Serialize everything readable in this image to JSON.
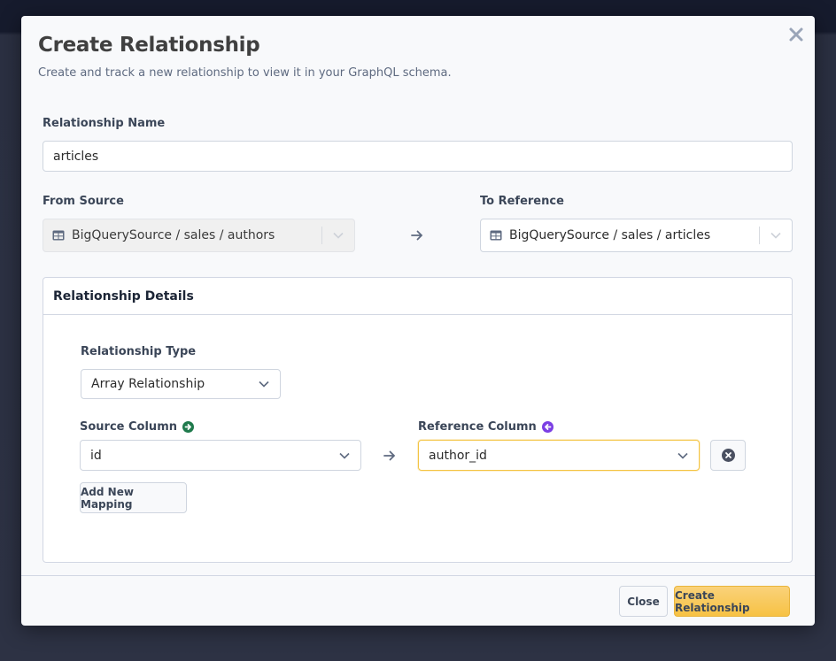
{
  "modal": {
    "title": "Create Relationship",
    "subtitle": "Create and track a new relationship to view it in your GraphQL schema.",
    "close_icon": "close-x-icon"
  },
  "form": {
    "name": {
      "label": "Relationship Name",
      "value": "articles"
    },
    "from_source": {
      "label": "From Source",
      "value": "BigQuerySource / sales / authors",
      "icon": "table-icon",
      "disabled": true
    },
    "to_reference": {
      "label": "To Reference",
      "value": "BigQuerySource / sales / articles",
      "icon": "table-icon"
    },
    "direction_icon": "arrow-right-icon"
  },
  "details": {
    "heading": "Relationship Details",
    "type": {
      "label": "Relationship Type",
      "value": "Array Relationship"
    },
    "source_column": {
      "label": "Source Column",
      "value": "id",
      "icon": "arrow-circle-right-icon",
      "icon_color": "#1f7a4c"
    },
    "reference_column": {
      "label": "Reference Column",
      "value": "author_id",
      "icon": "arrow-circle-left-icon",
      "icon_color": "#7b3fe4"
    },
    "remove_mapping_icon": "x-circle-icon",
    "add_mapping_label": "Add New Mapping"
  },
  "footer": {
    "close_label": "Close",
    "create_label": "Create Relationship"
  },
  "colors": {
    "primary": "#f7c244",
    "focus": "#f4c443",
    "source_icon": "#1f7a4c",
    "reference_icon": "#7b3fe4"
  }
}
